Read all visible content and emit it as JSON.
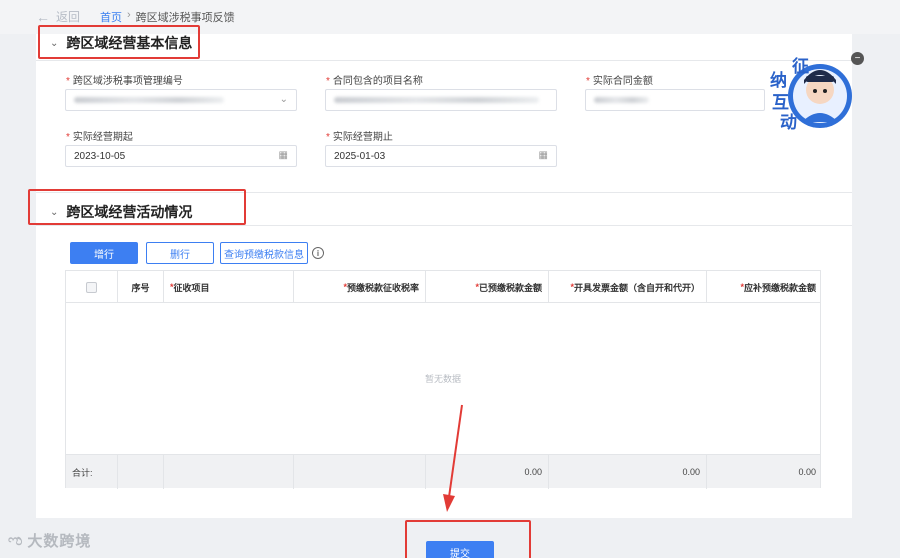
{
  "header": {
    "back_label": "返回",
    "breadcrumb": [
      "首页",
      "跨区域涉税事项反馈"
    ]
  },
  "section1": {
    "title": "跨区域经营基本信息",
    "fields": [
      {
        "label": "跨区域涉税事项管理编号",
        "value": "",
        "required": true,
        "control": "select"
      },
      {
        "label": "合同包含的项目名称",
        "value": "",
        "required": true,
        "control": "text"
      },
      {
        "label": "实际合同金额",
        "value": "",
        "required": true,
        "control": "text"
      },
      {
        "label": "实际经营期起",
        "value": "2023-10-05",
        "required": true,
        "control": "date"
      },
      {
        "label": "实际经营期止",
        "value": "2025-01-03",
        "required": true,
        "control": "date"
      }
    ]
  },
  "section2": {
    "title": "跨区域经营活动情况",
    "buttons": {
      "add": "增行",
      "delete": "删行",
      "query": "查询预缴税款信息"
    },
    "table": {
      "columns": [
        "",
        "序号",
        "征收项目",
        "预缴税款征收税率",
        "已预缴税款金额",
        "开具发票金额（含自开和代开）",
        "应补预缴税款金额"
      ],
      "required_columns": [
        false,
        false,
        true,
        true,
        true,
        true,
        true
      ],
      "empty_text": "暂无数据",
      "footer": {
        "label": "合计:",
        "totals": [
          "0.00",
          "0.00",
          "0.00"
        ]
      }
    }
  },
  "submit_label": "提交",
  "mascot": {
    "chars": [
      "征",
      "纳",
      "互",
      "动"
    ]
  },
  "watermark": "大数跨境",
  "colors": {
    "primary": "#3d7ff2",
    "highlight": "#e23b36",
    "required": "#e23b36"
  }
}
